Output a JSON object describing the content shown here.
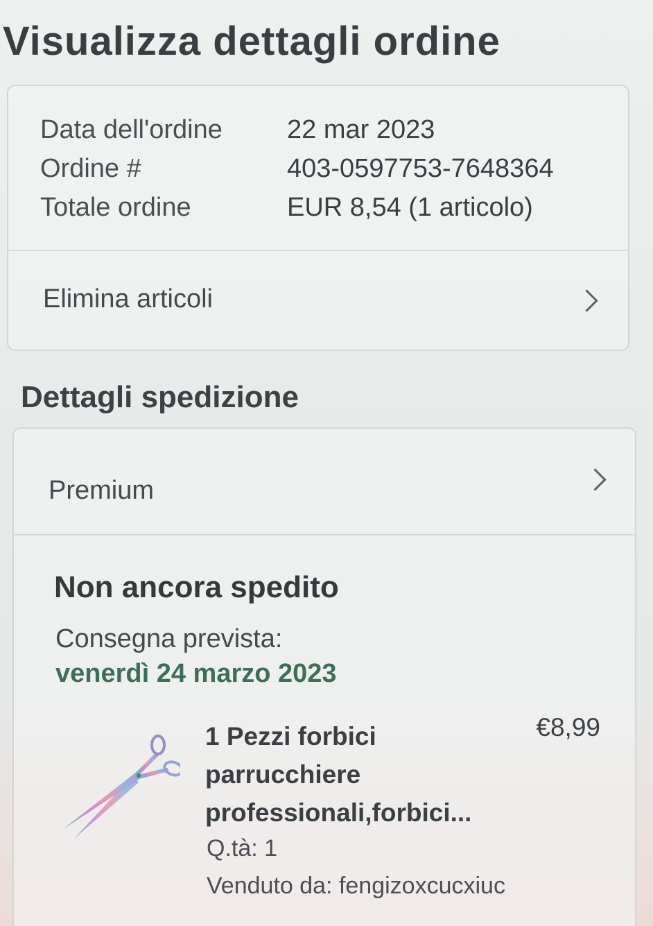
{
  "header": {
    "title": "Visualizza dettagli ordine"
  },
  "order_summary": {
    "rows": [
      {
        "label": "Data dell'ordine",
        "value": "22 mar 2023"
      },
      {
        "label": "Ordine #",
        "value": "403-0597753-7648364"
      },
      {
        "label": "Totale ordine",
        "value": "EUR 8,54 (1 articolo)"
      }
    ],
    "remove_items_label": "Elimina articoli"
  },
  "shipping": {
    "section_title": "Dettagli spedizione",
    "method_label": "Premium",
    "status": "Non ancora spedito",
    "delivery_label": "Consegna prevista:",
    "delivery_date": "venerdì 24 marzo 2023",
    "delivery_date_color": "#3f6e57",
    "item": {
      "name": "1 Pezzi forbici parrucchiere professionali,forbici...",
      "price": "€8,99",
      "quantity": "Q.tà: 1",
      "seller": "Venduto da: fengizoxcucxiuc",
      "image_icon": "scissors-icon"
    }
  },
  "icons": {
    "chevron": "chevron-right-icon"
  }
}
